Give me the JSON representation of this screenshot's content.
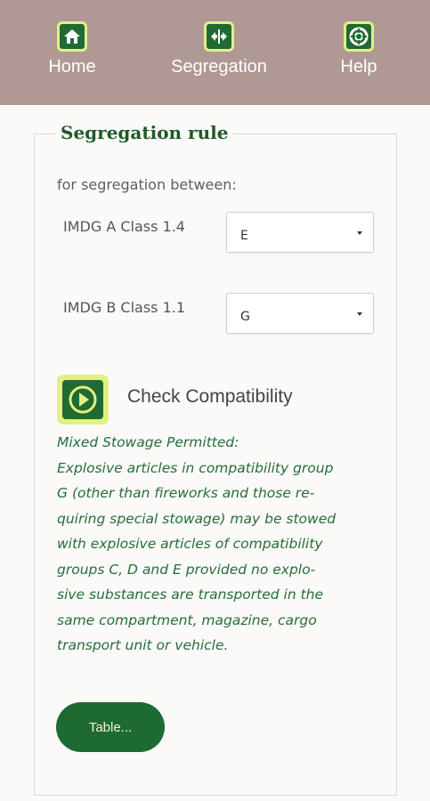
{
  "nav": {
    "items": [
      {
        "label": "Home",
        "icon": "home-icon"
      },
      {
        "label": "Segregation",
        "icon": "segregation-icon"
      },
      {
        "label": "Help",
        "icon": "lifebuoy-icon"
      }
    ]
  },
  "colors": {
    "topbar": "#b09894",
    "brand_green": "#1f6b33",
    "accent_yellow": "#e3f07f",
    "text_green": "#256d3a"
  },
  "panel": {
    "title": "Segregation rule",
    "intro": "for segregation between:",
    "rows": [
      {
        "label": "IMDG A Class 1.4",
        "value": "E"
      },
      {
        "label": "IMDG B Class 1.1",
        "value": "G"
      }
    ],
    "check_label": "Check Compatibility",
    "result_lines": [
      "Mixed Stowage Permitted:",
      "Explosive articles in compatibility group",
      "G (other than fireworks and those re-",
      "quiring special stowage) may be stowed",
      "with explosive articles of compatibility",
      "groups C, D and E provided no explo-",
      "sive substances are transported in the",
      "same compartment, magazine, cargo",
      "transport unit or vehicle."
    ],
    "table_button": "Table..."
  }
}
